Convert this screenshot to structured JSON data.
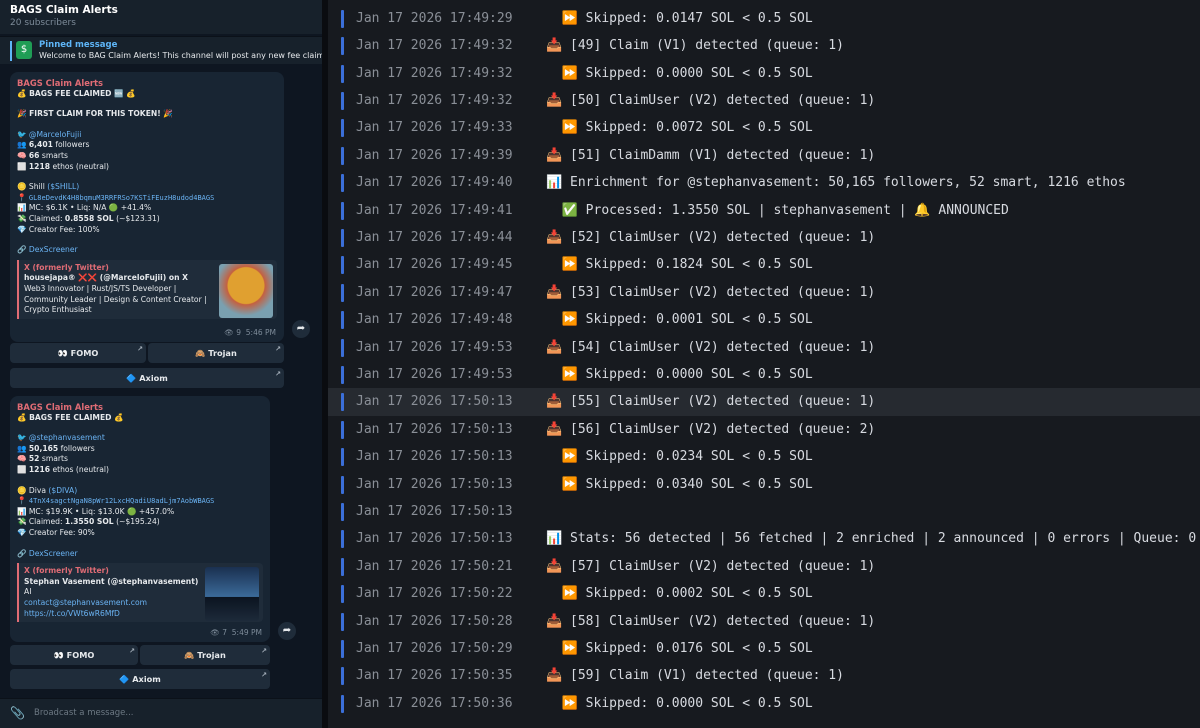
{
  "channel": {
    "title": "BAGS Claim Alerts",
    "subscribers": "20 subscribers",
    "pinned_label": "Pinned message",
    "pinned_text": "Welcome to BAG Claim Alerts!  This channel will post any new fee claim from",
    "composer_placeholder": "Broadcast a message..."
  },
  "messages": [
    {
      "channel": "BAGS Claim Alerts",
      "headline": "💰 BAGS FEE CLAIMED 🆕 💰",
      "first_claim": "🎉 FIRST CLAIM FOR THIS TOKEN! 🎉",
      "user": "@MarceloFujii",
      "followers": "6,401",
      "followers_label": "followers",
      "smarts": "66",
      "smarts_label": "smarts",
      "ethos": "1218",
      "ethos_label": "ethos (neutral)",
      "token_name": "Shill",
      "token_symbol": "($SHILL)",
      "address": "GL8eDevdK4H8bqmuM3RRFRSo7KSTiFEuzH8udod4BAGS",
      "mc_line": "MC: $6.1K • Liq: N/A 🟢 +41.4%",
      "claimed_label": "Claimed:",
      "claimed": "0.8558 SOL",
      "claimed_usd": "(~$123.31)",
      "creator_fee": "Creator Fee: 100%",
      "dex_link": "DexScreener",
      "card_source": "X (formerly Twitter)",
      "card_title": "housejapa® ❌❌ (@MarceloFujii) on X",
      "card_lines": [
        "Web3 Innovator | Rust/JS/TS Developer |",
        "Community Leader | Design & Content Creator |",
        "Crypto Enthusiast"
      ],
      "views": "9",
      "time": "5:46 PM",
      "buttons": [
        "👀 FOMO",
        "🙈 Trojan",
        "🔷 Axiom"
      ]
    },
    {
      "channel": "BAGS Claim Alerts",
      "headline": "💰 BAGS FEE CLAIMED 💰",
      "user": "@stephanvasement",
      "followers": "50,165",
      "followers_label": "followers",
      "smarts": "52",
      "smarts_label": "smarts",
      "ethos": "1216",
      "ethos_label": "ethos (neutral)",
      "token_name": "Diva",
      "token_symbol": "($DIVA)",
      "address": "4TnX4sagctNgaN8pWr12LxcHQadiU8adLjm7AobWBAGS",
      "mc_line": "MC: $19.9K • Liq: $13.0K 🟢 +457.0%",
      "claimed_label": "Claimed:",
      "claimed": "1.3550 SOL",
      "claimed_usd": "(~$195.24)",
      "creator_fee": "Creator Fee: 90%",
      "dex_link": "DexScreener",
      "card_source": "X (formerly Twitter)",
      "card_title": "Stephan Vasement (@stephanvasement) on X",
      "card_lines": [
        "AI"
      ],
      "card_links": [
        "contact@stephanvasement.com",
        "https://t.co/VWt6wR6MfD"
      ],
      "views": "7",
      "time": "5:49 PM",
      "buttons": [
        "👀 FOMO",
        "🙈 Trojan",
        "🔷 Axiom"
      ]
    }
  ],
  "terminal": {
    "lines": [
      {
        "ts": "Jan 17 2026 17:49:29",
        "text": "  ⏩ Skipped: 0.0147 SOL < 0.5 SOL"
      },
      {
        "ts": "Jan 17 2026 17:49:32",
        "text": "📥 [49] Claim (V1) detected (queue: 1)"
      },
      {
        "ts": "Jan 17 2026 17:49:32",
        "text": "  ⏩ Skipped: 0.0000 SOL < 0.5 SOL"
      },
      {
        "ts": "Jan 17 2026 17:49:32",
        "text": "📥 [50] ClaimUser (V2) detected (queue: 1)"
      },
      {
        "ts": "Jan 17 2026 17:49:33",
        "text": "  ⏩ Skipped: 0.0072 SOL < 0.5 SOL"
      },
      {
        "ts": "Jan 17 2026 17:49:39",
        "text": "📥 [51] ClaimDamm (V1) detected (queue: 1)"
      },
      {
        "ts": "Jan 17 2026 17:49:40",
        "text": "📊 Enrichment for @stephanvasement: 50,165 followers, 52 smart, 1216 ethos"
      },
      {
        "ts": "Jan 17 2026 17:49:41",
        "text": "  ✅ Processed: 1.3550 SOL | stephanvasement | 🔔 ANNOUNCED"
      },
      {
        "ts": "Jan 17 2026 17:49:44",
        "text": "📥 [52] ClaimUser (V2) detected (queue: 1)"
      },
      {
        "ts": "Jan 17 2026 17:49:45",
        "text": "  ⏩ Skipped: 0.1824 SOL < 0.5 SOL"
      },
      {
        "ts": "Jan 17 2026 17:49:47",
        "text": "📥 [53] ClaimUser (V2) detected (queue: 1)"
      },
      {
        "ts": "Jan 17 2026 17:49:48",
        "text": "  ⏩ Skipped: 0.0001 SOL < 0.5 SOL"
      },
      {
        "ts": "Jan 17 2026 17:49:53",
        "text": "📥 [54] ClaimUser (V2) detected (queue: 1)"
      },
      {
        "ts": "Jan 17 2026 17:49:53",
        "text": "  ⏩ Skipped: 0.0000 SOL < 0.5 SOL"
      },
      {
        "ts": "Jan 17 2026 17:50:13",
        "text": "📥 [55] ClaimUser (V2) detected (queue: 1)"
      },
      {
        "ts": "Jan 17 2026 17:50:13",
        "text": "📥 [56] ClaimUser (V2) detected (queue: 2)"
      },
      {
        "ts": "Jan 17 2026 17:50:13",
        "text": "  ⏩ Skipped: 0.0234 SOL < 0.5 SOL"
      },
      {
        "ts": "Jan 17 2026 17:50:13",
        "text": "  ⏩ Skipped: 0.0340 SOL < 0.5 SOL"
      },
      {
        "ts": "Jan 17 2026 17:50:13",
        "text": ""
      },
      {
        "ts": "Jan 17 2026 17:50:13",
        "text": "📊 Stats: 56 detected | 56 fetched | 2 enriched | 2 announced | 0 errors | Queue: 0"
      },
      {
        "ts": "Jan 17 2026 17:50:21",
        "text": "📥 [57] ClaimUser (V2) detected (queue: 1)"
      },
      {
        "ts": "Jan 17 2026 17:50:22",
        "text": "  ⏩ Skipped: 0.0002 SOL < 0.5 SOL"
      },
      {
        "ts": "Jan 17 2026 17:50:28",
        "text": "📥 [58] ClaimUser (V2) detected (queue: 1)"
      },
      {
        "ts": "Jan 17 2026 17:50:29",
        "text": "  ⏩ Skipped: 0.0176 SOL < 0.5 SOL"
      },
      {
        "ts": "Jan 17 2026 17:50:35",
        "text": "📥 [59] Claim (V1) detected (queue: 1)"
      },
      {
        "ts": "Jan 17 2026 17:50:36",
        "text": "  ⏩ Skipped: 0.0000 SOL < 0.5 SOL"
      }
    ]
  },
  "colors": {
    "accent": "#5eb5f7",
    "channel_name": "#e06c75",
    "log_bar": "#3b6fd9",
    "terminal_bg": "#171a1f"
  }
}
